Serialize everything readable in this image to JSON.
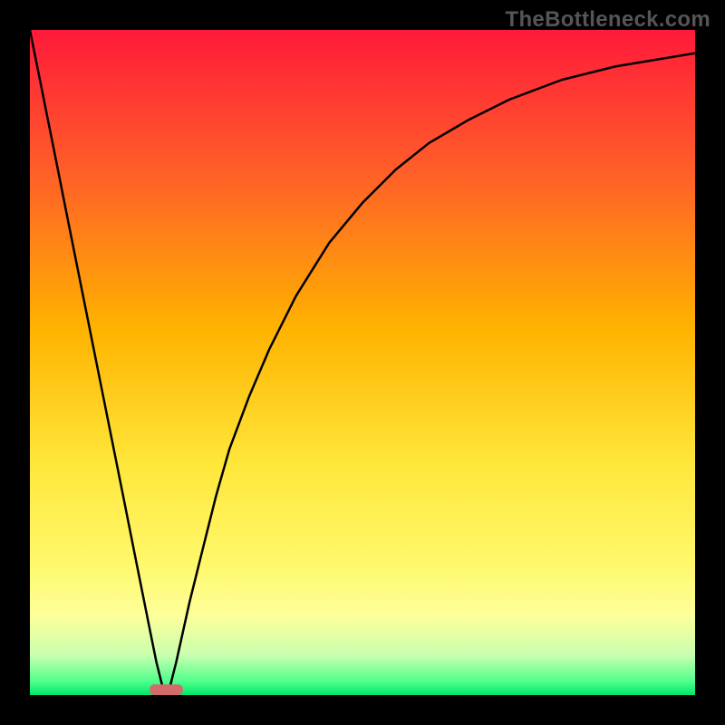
{
  "watermark": "TheBottleneck.com",
  "chart_data": {
    "type": "line",
    "title": "",
    "xlabel": "",
    "ylabel": "",
    "xlim": [
      0,
      100
    ],
    "ylim": [
      0,
      100
    ],
    "grid": false,
    "legend": false,
    "gradient_stops": [
      {
        "offset": 0,
        "color": "#ff1a3a"
      },
      {
        "offset": 20,
        "color": "#ff5a2a"
      },
      {
        "offset": 45,
        "color": "#ffb300"
      },
      {
        "offset": 65,
        "color": "#ffe63a"
      },
      {
        "offset": 80,
        "color": "#fff86a"
      },
      {
        "offset": 88,
        "color": "#fdff9a"
      },
      {
        "offset": 94,
        "color": "#c9ffb0"
      },
      {
        "offset": 98,
        "color": "#4dff8a"
      },
      {
        "offset": 100,
        "color": "#00e66a"
      }
    ],
    "marker": {
      "x": 20.5,
      "y": 0.8,
      "width": 5,
      "height": 1.6,
      "color": "#d36b6b",
      "name": "min-marker"
    },
    "series": [
      {
        "name": "curve",
        "x": [
          0,
          2,
          4,
          6,
          8,
          10,
          12,
          14,
          16,
          18,
          19,
          20,
          21,
          22,
          24,
          26,
          28,
          30,
          33,
          36,
          40,
          45,
          50,
          55,
          60,
          66,
          72,
          80,
          88,
          94,
          100
        ],
        "y": [
          100,
          90,
          80,
          70,
          60,
          50,
          40,
          30,
          20,
          10,
          5,
          1,
          1,
          5,
          14,
          22,
          30,
          37,
          45,
          52,
          60,
          68,
          74,
          79,
          83,
          86.5,
          89.5,
          92.5,
          94.5,
          95.5,
          96.5
        ]
      }
    ]
  }
}
